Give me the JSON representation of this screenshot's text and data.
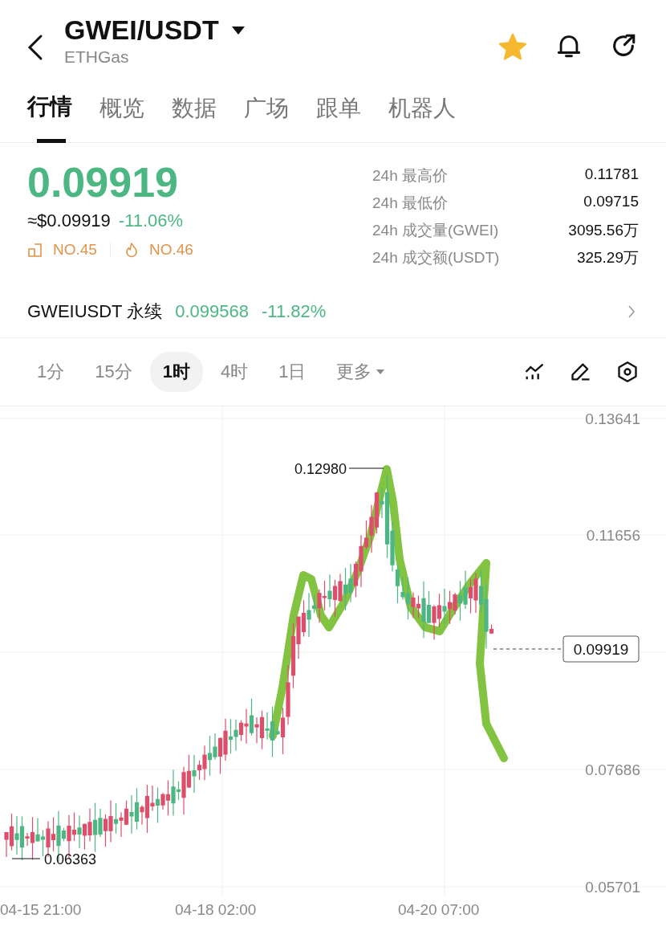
{
  "header": {
    "title": "GWEI/USDT",
    "subtitle": "ETHGas",
    "favorite": true
  },
  "tabs": [
    {
      "label": "行情",
      "selected": true
    },
    {
      "label": "概览",
      "selected": false
    },
    {
      "label": "数据",
      "selected": false
    },
    {
      "label": "广场",
      "selected": false
    },
    {
      "label": "跟单",
      "selected": false
    },
    {
      "label": "机器人",
      "selected": false
    }
  ],
  "price": {
    "last": "0.09919",
    "usd": "≈$0.09919",
    "change": "-11.06%",
    "ranks": [
      {
        "kind": "market_cap",
        "label": "NO.45"
      },
      {
        "kind": "hot",
        "label": "NO.46"
      }
    ]
  },
  "stats": [
    {
      "label": "24h 最高价",
      "value": "0.11781"
    },
    {
      "label": "24h 最低价",
      "value": "0.09715"
    },
    {
      "label": "24h 成交量(GWEI)",
      "value": "3095.56万"
    },
    {
      "label": "24h 成交额(USDT)",
      "value": "325.29万"
    }
  ],
  "perpetual": {
    "name": "GWEIUSDT 永续",
    "price": "0.099568",
    "change": "-11.82%"
  },
  "timeframes": [
    {
      "label": "1分",
      "selected": false,
      "kind": "plain"
    },
    {
      "label": "15分",
      "selected": false,
      "kind": "plain"
    },
    {
      "label": "1时",
      "selected": true,
      "kind": "plain"
    },
    {
      "label": "4时",
      "selected": false,
      "kind": "plain"
    },
    {
      "label": "1日",
      "selected": false,
      "kind": "plain"
    },
    {
      "label": "更多",
      "selected": false,
      "kind": "dropdown"
    }
  ],
  "chart": {
    "y_labels": [
      "0.13641",
      "0.11656",
      "0.07686",
      "0.05701"
    ],
    "x_labels": [
      "04-15 21:00",
      "04-18 02:00",
      "04-20 07:00"
    ],
    "high_marker": "0.12980",
    "low_marker": "0.06363",
    "current_price": "0.09919"
  }
}
